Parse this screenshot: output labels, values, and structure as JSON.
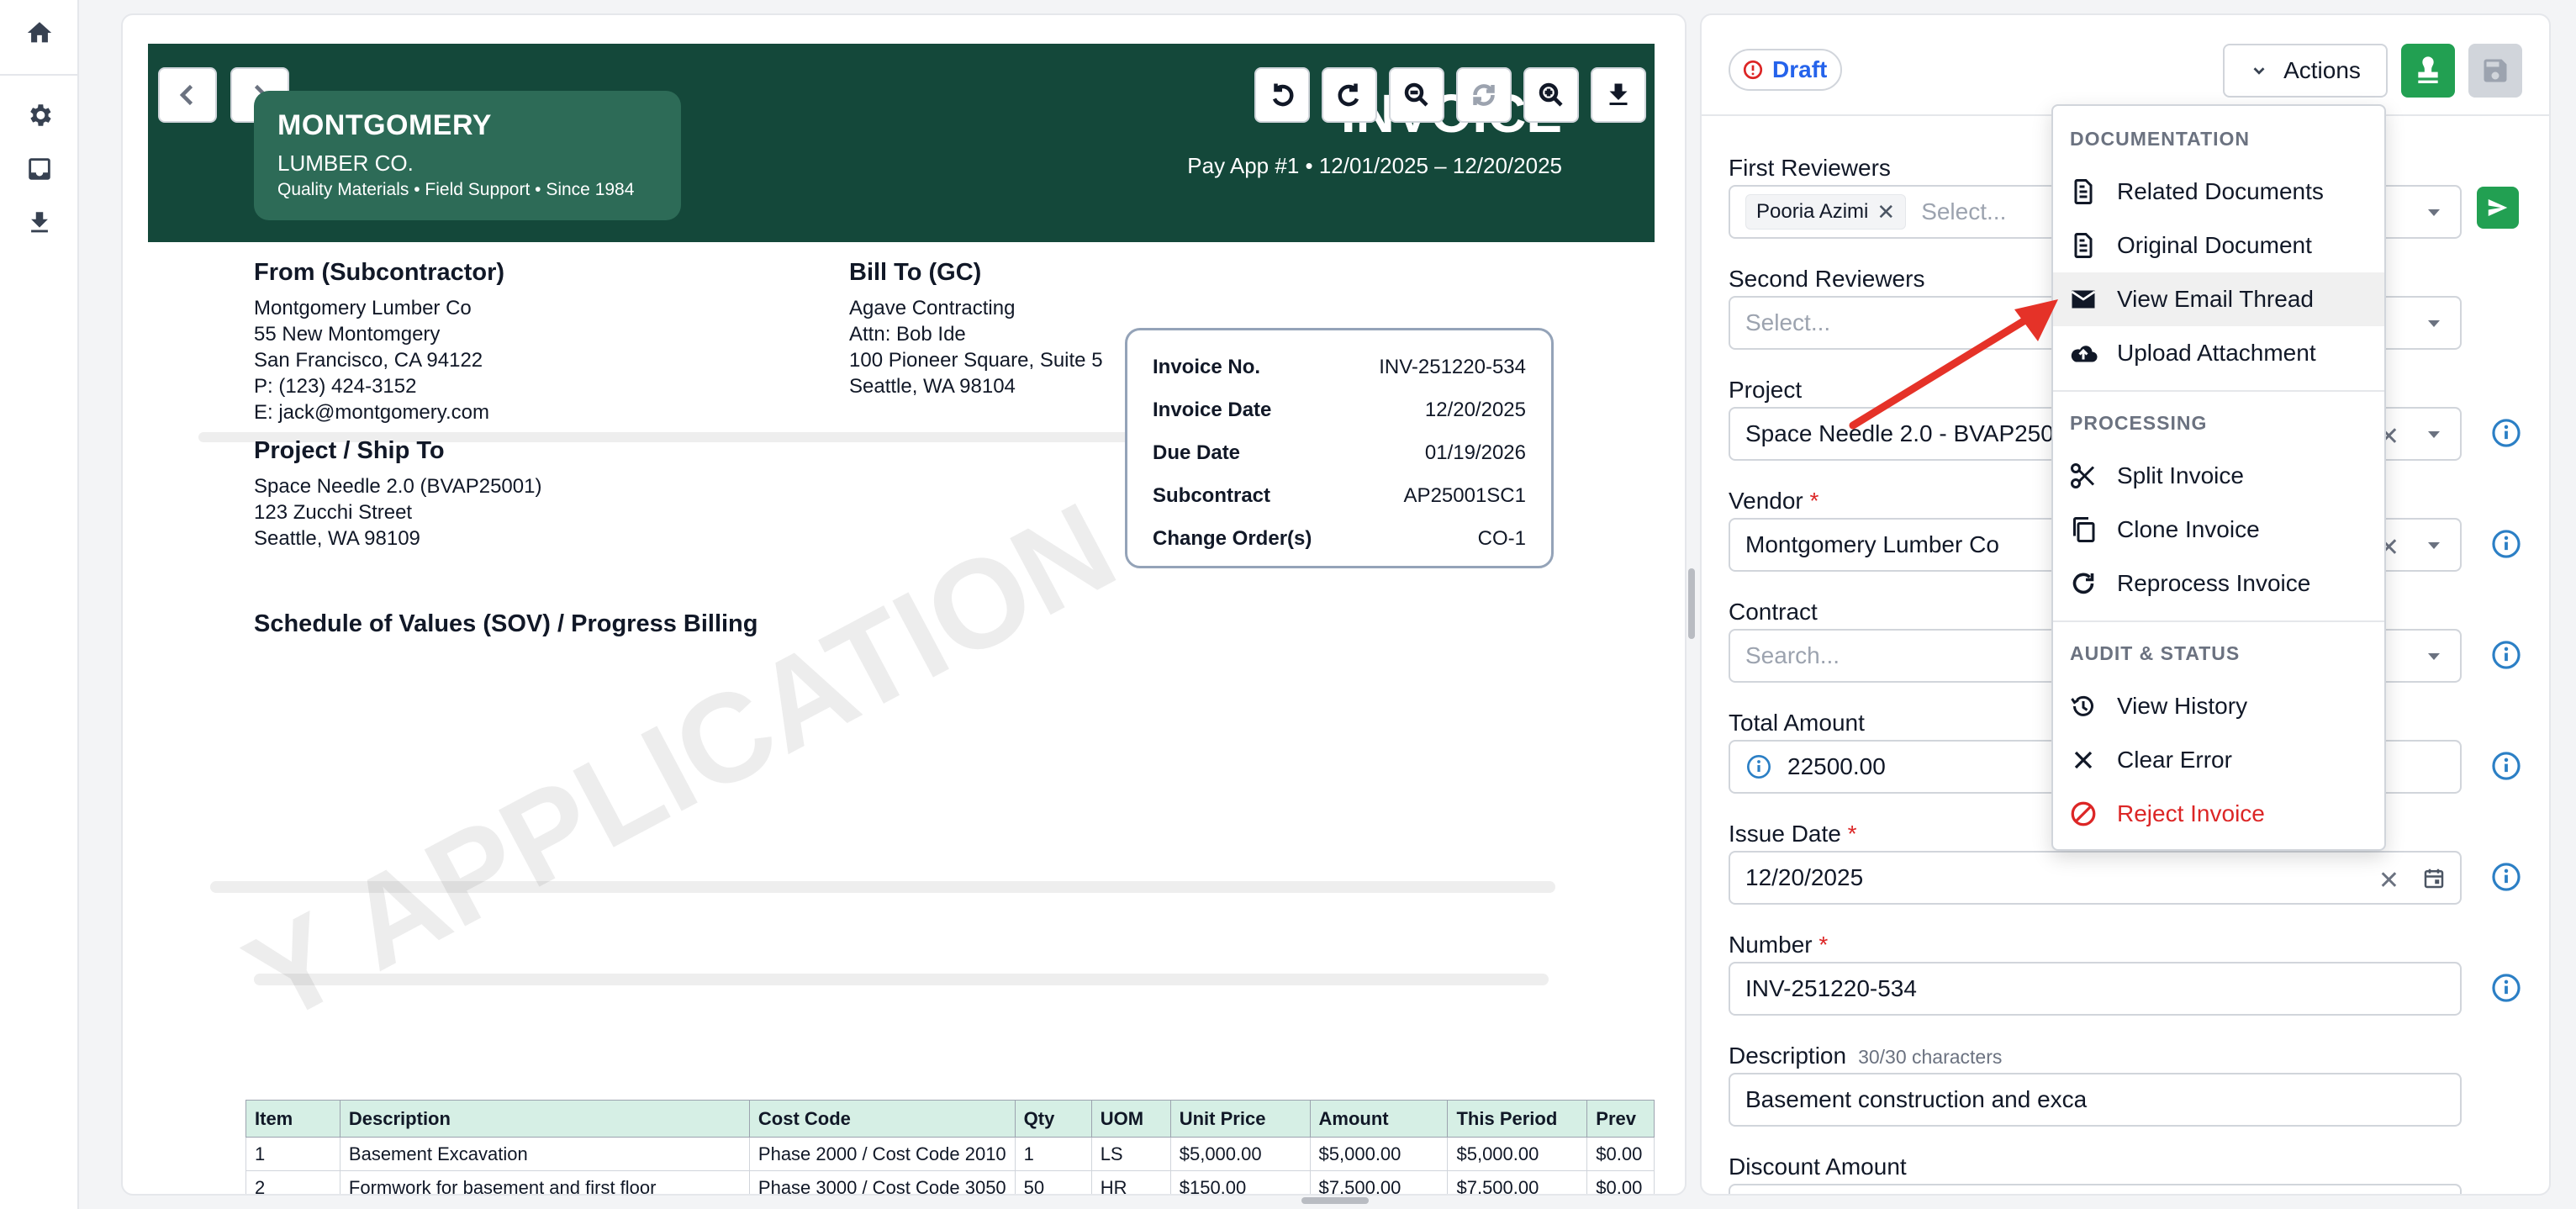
{
  "rail": {
    "icons": [
      "home-icon",
      "gear-icon",
      "inbox-icon",
      "download-icon"
    ]
  },
  "viewer": {
    "header": {
      "company_name": "MONTGOMERY",
      "company_sub": "LUMBER CO.",
      "company_tagline": "Quality Materials • Field Support • Since 1984",
      "doc_title": "INVOICE",
      "pay_app": "Pay App #1 • 12/01/2025 – 12/20/2025"
    },
    "from": {
      "title": "From (Subcontractor)",
      "lines": [
        "Montgomery Lumber Co",
        "55 New Montomgery",
        "San Francisco, CA 94122",
        "P: (123) 424-3152",
        "E: jack@montgomery.com"
      ]
    },
    "bill_to": {
      "title": "Bill To (GC)",
      "lines": [
        "Agave Contracting",
        "Attn: Bob Ide",
        "100 Pioneer Square, Suite 5",
        "Seattle, WA 98104"
      ]
    },
    "ship_to": {
      "title": "Project / Ship To",
      "lines": [
        "Space Needle 2.0 (BVAP25001)",
        "123 Zucchi Street",
        "Seattle, WA 98109"
      ]
    },
    "invoice_box": {
      "rows": [
        {
          "k": "Invoice No.",
          "v": "INV-251220-534"
        },
        {
          "k": "Invoice Date",
          "v": "12/20/2025"
        },
        {
          "k": "Due Date",
          "v": "01/19/2026"
        },
        {
          "k": "Subcontract",
          "v": "AP25001SC1"
        },
        {
          "k": "Change Order(s)",
          "v": "CO-1"
        }
      ]
    },
    "sov_title": "Schedule of Values (SOV) / Progress Billing",
    "watermark": "Y APPLICATION",
    "table": {
      "headers": [
        "Item",
        "Description",
        "Cost Code",
        "Qty",
        "UOM",
        "Unit Price",
        "Amount",
        "This Period",
        "Prev"
      ],
      "rows": [
        [
          "1",
          "Basement Excavation",
          "Phase 2000 / Cost Code 2010",
          "1",
          "LS",
          "$5,000.00",
          "$5,000.00",
          "$5,000.00",
          "$0.00"
        ],
        [
          "2",
          "Formwork for basement and first floor",
          "Phase 3000 / Cost Code 3050",
          "50",
          "HR",
          "$150.00",
          "$7,500.00",
          "$7,500.00",
          "$0.00"
        ]
      ]
    }
  },
  "form": {
    "status": "Draft",
    "actions_label": "Actions",
    "first_reviewers": {
      "label": "First Reviewers",
      "chip": "Pooria Azimi",
      "placeholder": "Select..."
    },
    "second_reviewers": {
      "label": "Second Reviewers",
      "placeholder": "Select..."
    },
    "project": {
      "label": "Project",
      "value": "Space Needle 2.0 - BVAP25001"
    },
    "vendor": {
      "label": "Vendor",
      "required": "*",
      "value": "Montgomery Lumber Co"
    },
    "contract": {
      "label": "Contract",
      "placeholder": "Search..."
    },
    "total_amount": {
      "label": "Total Amount",
      "value": "22500.00"
    },
    "issue_date": {
      "label": "Issue Date",
      "required": "*",
      "value": "12/20/2025"
    },
    "number": {
      "label": "Number",
      "required": "*",
      "value": "INV-251220-534"
    },
    "description": {
      "label": "Description",
      "hint": "30/30 characters",
      "value": "Basement construction and exca"
    },
    "discount": {
      "label": "Discount Amount"
    }
  },
  "menu": {
    "sections": [
      {
        "title": "DOCUMENTATION",
        "items": [
          {
            "label": "Related Documents",
            "icon": "document-icon"
          },
          {
            "label": "Original Document",
            "icon": "document-icon"
          },
          {
            "label": "View Email Thread",
            "icon": "mail-icon"
          },
          {
            "label": "Upload Attachment",
            "icon": "cloud-upload-icon"
          }
        ]
      },
      {
        "title": "PROCESSING",
        "items": [
          {
            "label": "Split Invoice",
            "icon": "scissors-icon"
          },
          {
            "label": "Clone Invoice",
            "icon": "copy-icon"
          },
          {
            "label": "Reprocess Invoice",
            "icon": "refresh-icon"
          }
        ]
      },
      {
        "title": "AUDIT & STATUS",
        "items": [
          {
            "label": "View History",
            "icon": "history-icon"
          },
          {
            "label": "Clear Error",
            "icon": "close-icon"
          },
          {
            "label": "Reject Invoice",
            "icon": "block-icon"
          }
        ]
      }
    ]
  },
  "colors": {
    "header_green": "#14483a",
    "logo_green": "#2d6b57",
    "accent_green": "#22a052",
    "draft_blue": "#2563eb",
    "danger_red": "#dc2626",
    "arrow_red": "#e53228"
  }
}
